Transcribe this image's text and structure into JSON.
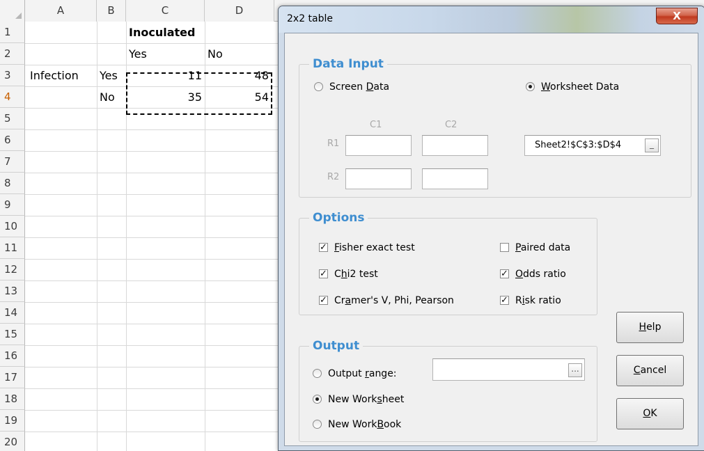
{
  "sheet": {
    "columns": [
      "A",
      "B",
      "C",
      "D"
    ],
    "rows": [
      "1",
      "2",
      "3",
      "4",
      "5",
      "6",
      "7",
      "8",
      "9",
      "10",
      "11",
      "12",
      "13",
      "14",
      "15",
      "16",
      "17",
      "18",
      "19",
      "20"
    ],
    "cells": {
      "c1": "Inoculated",
      "c2": "Yes",
      "d2": "No",
      "a3": "Infection",
      "b3": "Yes",
      "c3": "11",
      "d3": "48",
      "b4": "No",
      "c4": "35",
      "d4": "54"
    }
  },
  "dialog": {
    "title": "2x2 table",
    "close_label": "X",
    "data_input": {
      "legend": "Data Input",
      "screen_data": {
        "pre": "Screen ",
        "key": "D",
        "post": "ata",
        "selected": false
      },
      "worksheet_data": {
        "pre": "",
        "key": "W",
        "post": "orksheet Data",
        "selected": true
      },
      "c1_label": "C1",
      "c2_label": "C2",
      "r1_label": "R1",
      "r2_label": "R2",
      "range_value": "Sheet2!$C$3:$D$4",
      "range_button": "_"
    },
    "options": {
      "legend": "Options",
      "fisher": {
        "pre": "",
        "key": "F",
        "post": "isher exact test",
        "checked": true
      },
      "chi2": {
        "pre": "C",
        "key": "h",
        "post": "i2 test",
        "checked": true
      },
      "cramer": {
        "pre": "Cr",
        "key": "a",
        "post": "mer's V, Phi, Pearson",
        "checked": true
      },
      "paired": {
        "pre": "",
        "key": "P",
        "post": "aired data",
        "checked": false
      },
      "odds": {
        "pre": "",
        "key": "O",
        "post": "dds ratio",
        "checked": true
      },
      "risk": {
        "pre": "R",
        "key": "i",
        "post": "sk ratio",
        "checked": true
      },
      "check_mark": "✓"
    },
    "output": {
      "legend": "Output",
      "output_range": {
        "pre": "Output ",
        "key": "r",
        "post": "ange:",
        "selected": false
      },
      "new_worksheet": {
        "pre": "New Work",
        "key": "s",
        "post": "heet",
        "selected": true
      },
      "new_workbook": {
        "pre": "New Work",
        "key": "B",
        "post": "ook",
        "selected": false
      },
      "range_button": "..."
    },
    "buttons": {
      "help": {
        "pre": "",
        "key": "H",
        "post": "elp"
      },
      "cancel": {
        "pre": "",
        "key": "C",
        "post": "ancel"
      },
      "ok": {
        "pre": "",
        "key": "O",
        "post": "K"
      }
    }
  }
}
